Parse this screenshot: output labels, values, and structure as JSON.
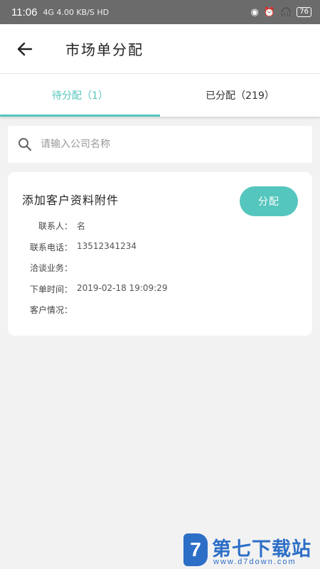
{
  "status_bar": {
    "time": "11:06",
    "network": "4G 4.00 KB/S HD",
    "battery": "76"
  },
  "app_bar": {
    "title": "市场单分配"
  },
  "tabs": [
    {
      "label": "待分配（1）",
      "active": true
    },
    {
      "label": "已分配（219）",
      "active": false
    }
  ],
  "search": {
    "placeholder": "请输入公司名称",
    "value": ""
  },
  "order_card": {
    "name": "添加客户资料附件",
    "assign_label": "分配",
    "fields": [
      {
        "label": "联系人：",
        "value": "名"
      },
      {
        "label": "联系电话：",
        "value": "13512341234"
      },
      {
        "label": "洽谈业务：",
        "value": ""
      },
      {
        "label": "下单时间：",
        "value": "2019-02-18 19:09:29"
      },
      {
        "label": "客户情况：",
        "value": ""
      }
    ]
  },
  "watermark": {
    "logo_letter": "7",
    "title": "第七下载站",
    "url": "www.d7down.com"
  },
  "colors": {
    "accent": "#55c6be",
    "status_bar": "#6b6b6b",
    "background": "#f2f2f2",
    "watermark": "#2d6fc7"
  },
  "icons": [
    "back-arrow-icon",
    "search-icon",
    "wifi-icon",
    "alarm-icon",
    "headphones-icon",
    "battery-icon"
  ]
}
